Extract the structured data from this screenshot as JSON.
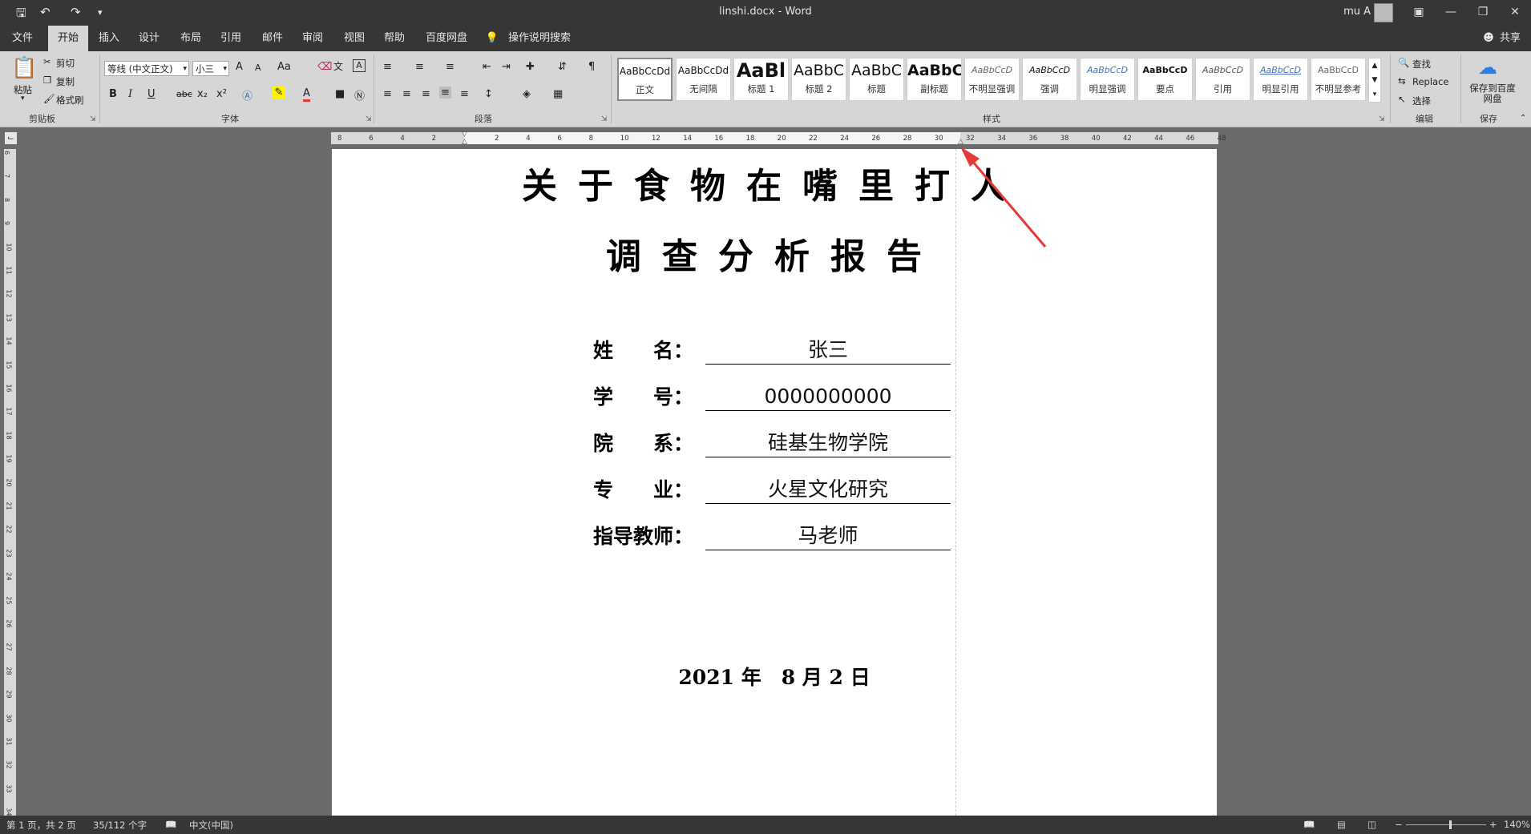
{
  "titlebar": {
    "document_title": "linshi.docx  -  Word",
    "user_name": "mu A",
    "quick_access": [
      "save-icon",
      "undo-icon",
      "redo-icon",
      "customize-icon"
    ]
  },
  "menu": {
    "items": [
      "文件",
      "开始",
      "插入",
      "设计",
      "布局",
      "引用",
      "邮件",
      "审阅",
      "视图",
      "帮助",
      "百度网盘"
    ],
    "active": "开始",
    "tell_me": "操作说明搜索",
    "share": "共享"
  },
  "ribbon": {
    "clipboard": {
      "label": "剪贴板",
      "paste": "粘贴",
      "cut": "剪切",
      "copy": "复制",
      "format_painter": "格式刷"
    },
    "font": {
      "label": "字体",
      "font_name": "等线 (中文正文)",
      "font_size": "小三",
      "bold": "B",
      "italic": "I",
      "underline": "U",
      "strike": "abc",
      "subscript": "x₂",
      "superscript": "x²",
      "grow": "A",
      "shrink": "A",
      "case": "Aa",
      "font_color": "A",
      "char_border": "A"
    },
    "paragraph": {
      "label": "段落"
    },
    "styles": {
      "label": "样式",
      "items": [
        {
          "preview": "AaBbCcDd",
          "name": "正文"
        },
        {
          "preview": "AaBbCcDd",
          "name": "无间隔"
        },
        {
          "preview": "AaBl",
          "name": "标题 1"
        },
        {
          "preview": "AaBbC",
          "name": "标题 2"
        },
        {
          "preview": "AaBbC",
          "name": "标题"
        },
        {
          "preview": "AaBbC",
          "name": "副标题"
        },
        {
          "preview": "AaBbCcD",
          "name": "不明显强调"
        },
        {
          "preview": "AaBbCcD",
          "name": "强调"
        },
        {
          "preview": "AaBbCcD",
          "name": "明显强调"
        },
        {
          "preview": "AaBbCcD",
          "name": "要点"
        },
        {
          "preview": "AaBbCcD",
          "name": "引用"
        },
        {
          "preview": "AaBbCcD",
          "name": "明显引用"
        },
        {
          "preview": "AaBbCcD",
          "name": "不明显参考"
        }
      ]
    },
    "editing": {
      "label": "编辑",
      "find": "查找",
      "replace": "Replace",
      "select": "选择"
    },
    "save": {
      "label": "保存",
      "button": "保存到百度网盘"
    }
  },
  "ruler": {
    "ticks": [
      "8",
      "6",
      "4",
      "2",
      "",
      "2",
      "4",
      "6",
      "8",
      "10",
      "12",
      "14",
      "16",
      "18",
      "20",
      "22",
      "24",
      "26",
      "28",
      "30",
      "32",
      "34",
      "36",
      "38",
      "40",
      "42",
      "44",
      "46",
      "48"
    ],
    "vticks": [
      "6",
      "7",
      "8",
      "9",
      "10",
      "11",
      "12",
      "13",
      "14",
      "15",
      "16",
      "17",
      "18",
      "19",
      "20",
      "21",
      "22",
      "23",
      "24",
      "25",
      "26",
      "27",
      "28",
      "29",
      "30",
      "31",
      "32",
      "33",
      "34"
    ]
  },
  "document": {
    "title_line1": "关于食物在嘴里打人",
    "title_line2": "调查分析报告",
    "fields": [
      {
        "label": "姓　　名：",
        "value": "张三"
      },
      {
        "label": "学　　号：",
        "value": "0000000000"
      },
      {
        "label": "院　　系：",
        "value": "硅基生物学院"
      },
      {
        "label": "专　　业：",
        "value": "火星文化研究"
      },
      {
        "label": "指导教师：",
        "value": "马老师"
      }
    ],
    "date": "2021 年　8 月 2 日"
  },
  "status": {
    "page": "第 1 页，共 2 页",
    "words": "35/112 个字",
    "language": "中文(中国)",
    "zoom": "140%"
  },
  "annotation_color": "#e53935"
}
